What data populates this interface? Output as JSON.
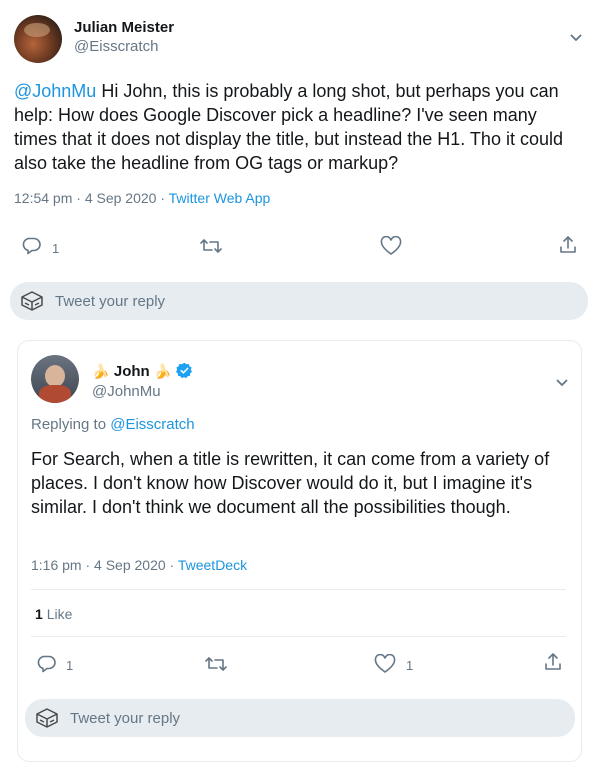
{
  "tweet": {
    "author_name": "Julian Meister",
    "author_handle": "@Eisscratch",
    "mention": "@JohnMu",
    "body": " Hi John, this is probably a long shot, but perhaps you can help: How does Google Discover pick a headline? I've seen many times that it does not display the title, but instead the H1. Tho it could also take the headline from OG tags or markup?",
    "time": "12:54 pm · 4 Sep 2020 · ",
    "app": "Twitter Web App",
    "reply_count": "1",
    "reply_placeholder": "Tweet your reply"
  },
  "reply": {
    "author_name": "John",
    "name_emoji": "🍌",
    "author_handle": "@JohnMu",
    "replying_to_label": "Replying to ",
    "replying_to_handle": "@Eisscratch",
    "body": "For Search, when a title is rewritten, it can come from a variety of places. I don't know how Discover would do it, but I imagine it's similar. I don't think we document all the possibilities though.",
    "time": "1:16 pm · 4 Sep 2020 · ",
    "app": "TweetDeck",
    "likes_count": "1",
    "likes_label": "Like",
    "reply_count": "1",
    "like_count": "1",
    "reply_placeholder": "Tweet your reply"
  },
  "colors": {
    "accent": "#1b95e0",
    "verified": "#1da1f2",
    "muted": "#657786",
    "reply_box_bg": "#e6ecf0"
  },
  "icons": [
    "chevron-down-icon",
    "reply-icon",
    "retweet-icon",
    "like-icon",
    "share-icon",
    "verified-icon",
    "composer-icon"
  ]
}
